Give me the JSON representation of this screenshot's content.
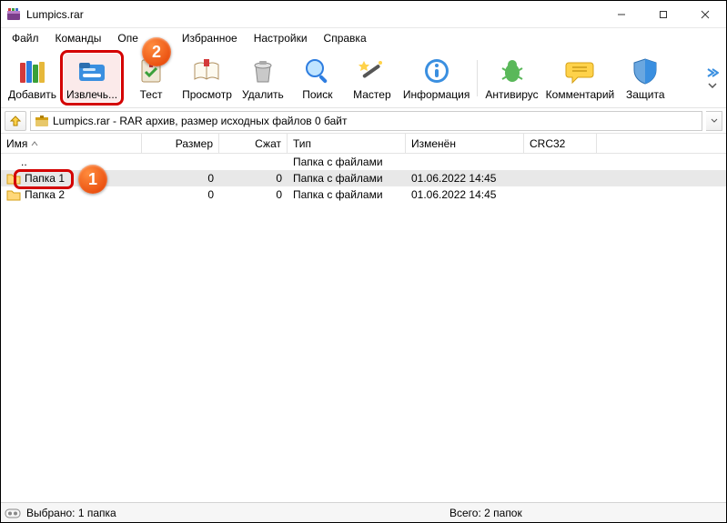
{
  "window": {
    "title": "Lumpics.rar"
  },
  "menu": {
    "file": "Файл",
    "commands": "Команды",
    "operations": "Опе",
    "favorites": "Избранное",
    "settings": "Настройки",
    "help": "Справка"
  },
  "toolbar": {
    "add": {
      "label": "Добавить"
    },
    "extract": {
      "label": "Извлечь..."
    },
    "test": {
      "label": "Тест"
    },
    "view": {
      "label": "Просмотр"
    },
    "delete": {
      "label": "Удалить"
    },
    "find": {
      "label": "Поиск"
    },
    "wizard": {
      "label": "Мастер"
    },
    "info": {
      "label": "Информация"
    },
    "antivirus": {
      "label": "Антивирус"
    },
    "comment": {
      "label": "Комментарий"
    },
    "protect": {
      "label": "Защита"
    }
  },
  "address": {
    "text": "Lumpics.rar - RAR архив, размер исходных файлов 0 байт"
  },
  "columns": {
    "name": "Имя",
    "size": "Размер",
    "packed": "Сжат",
    "type": "Тип",
    "modified": "Изменён",
    "crc": "CRC32"
  },
  "rows": [
    {
      "name": "..",
      "size": "",
      "packed": "",
      "type": "Папка с файлами",
      "modified": "",
      "crc": ""
    },
    {
      "name": "Папка 1",
      "size": "0",
      "packed": "0",
      "type": "Папка с файлами",
      "modified": "01.06.2022 14:45",
      "crc": ""
    },
    {
      "name": "Папка 2",
      "size": "0",
      "packed": "0",
      "type": "Папка с файлами",
      "modified": "01.06.2022 14:45",
      "crc": ""
    }
  ],
  "status": {
    "selected": "Выбрано: 1 папка",
    "total": "Всего: 2 папок"
  },
  "badges": {
    "one": "1",
    "two": "2"
  }
}
